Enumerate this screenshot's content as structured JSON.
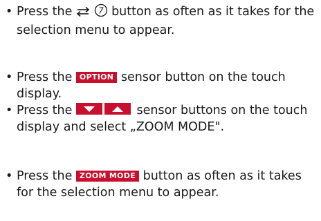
{
  "instructions": [
    {
      "bullet": "•",
      "pre": "Press the",
      "symbols": [
        "⭾",
        "⑦"
      ],
      "post": "button as often as it takes for the selection menu to appear."
    },
    {
      "bullet": "•",
      "pre": "Press the",
      "badge": "OPTION",
      "post": "sensor button on the touch display."
    },
    {
      "bullet": "•",
      "pre": "Press the",
      "arrows": [
        "down-arrow",
        "up-arrow"
      ],
      "post": "sensor buttons on the touch display and select „ZOOM MODE\"."
    },
    {
      "bullet": "•",
      "pre": "Press the",
      "badge": "ZOOM MODE",
      "post": "button as often as it takes for the selection menu to appear."
    }
  ],
  "colors": {
    "badge_bg": "#c8102e",
    "badge_text": "#ffffff",
    "text": "#1a1a1a"
  }
}
